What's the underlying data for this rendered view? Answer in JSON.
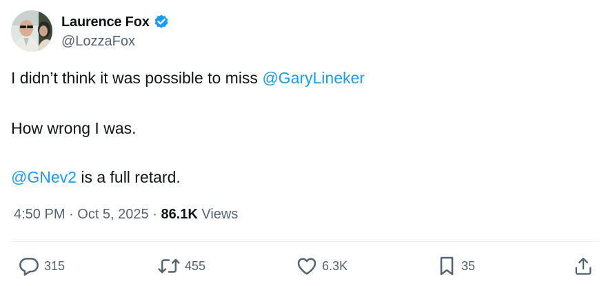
{
  "author": {
    "display_name": "Laurence Fox",
    "handle": "@LozzaFox",
    "verified": true,
    "avatar_icon": "profile-photo"
  },
  "tweet": {
    "line1_text": "I didn’t think it was possible to miss ",
    "line1_mention": "@GaryLineker",
    "line2_text": "How wrong I was.",
    "line3_mention": "@GNev2",
    "line3_text": " is a full retard."
  },
  "meta": {
    "time": "4:50 PM",
    "separator1": " · ",
    "date": "Oct 5, 2025",
    "separator2": " · ",
    "views_count": "86.1K",
    "views_label": " Views"
  },
  "actions": {
    "replies": "315",
    "retweets": "455",
    "likes": "6.3K",
    "bookmarks": "35"
  },
  "colors": {
    "mention": "#1d9bf0",
    "muted": "#536471",
    "text": "#0f1419",
    "verified": "#1d9bf0"
  }
}
